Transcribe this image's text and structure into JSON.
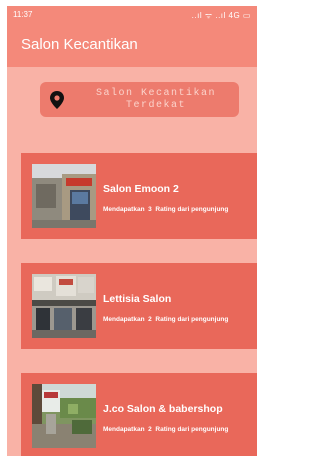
{
  "status_bar": {
    "time": "11:37",
    "indicators": "..ıl ᯤ ..ıl 4G ▭"
  },
  "app_bar": {
    "title": "Salon Kecantikan"
  },
  "nearby_button": {
    "label": "Salon Kecantikan\nTerdekat",
    "icon": "map-pin-icon"
  },
  "salons": [
    {
      "name": "Salon Emoon 2",
      "rating_prefix": "Mendapatkan",
      "rating_count": "3",
      "rating_suffix": "Rating dari pengunjung"
    },
    {
      "name": "Lettisia Salon",
      "rating_prefix": "Mendapatkan",
      "rating_count": "2",
      "rating_suffix": "Rating dari pengunjung"
    },
    {
      "name": "J.co Salon & babershop",
      "rating_prefix": "Mendapatkan",
      "rating_count": "2",
      "rating_suffix": "Rating dari pengunjung"
    }
  ],
  "colors": {
    "background": "#f9b2a6",
    "app_bar": "#f4897a",
    "card": "#e9685a",
    "button": "#ed7b6d",
    "text": "#ffffff"
  }
}
